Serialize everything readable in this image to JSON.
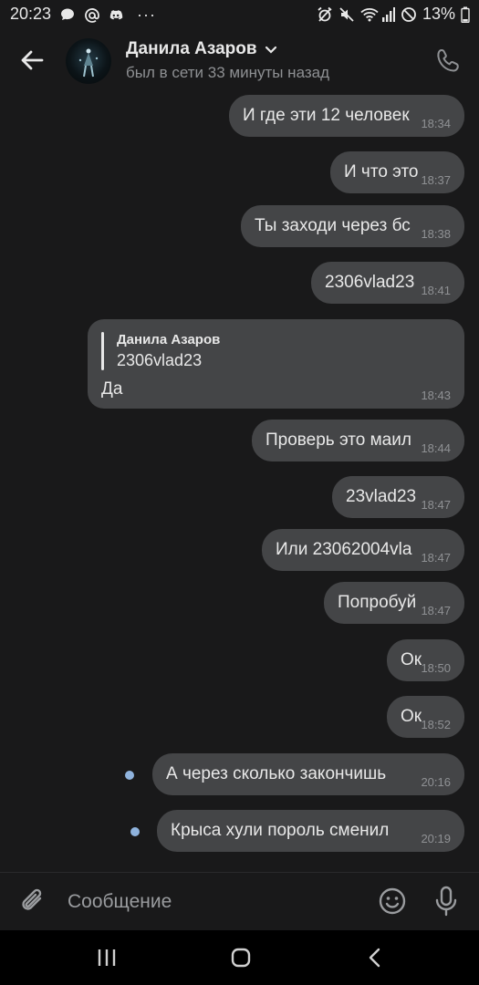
{
  "status_bar": {
    "time": "20:23",
    "more_dots": "···",
    "battery_percent": "13%",
    "left_icons": [
      "chat-bubble-icon",
      "at-sign-icon",
      "discord-icon"
    ],
    "right_icons": [
      "alarm-off-icon",
      "mute-icon",
      "wifi-icon",
      "signal-icon",
      "do-not-disturb-icon",
      "battery-icon"
    ]
  },
  "header": {
    "contact_name": "Данила Азаров",
    "contact_status": "был в сети 33 минуты назад",
    "icons": {
      "back": "arrow-left-icon",
      "call": "phone-icon",
      "chevron": "chevron-down-icon"
    }
  },
  "messages": [
    {
      "text": "И где эти 12 человек",
      "time": "18:34"
    },
    {
      "text": "И что это",
      "time": "18:37"
    },
    {
      "text": "Ты заходи через бс",
      "time": "18:38"
    },
    {
      "text": "2306vlad23",
      "time": "18:41"
    },
    {
      "reply_author": "Данила Азаров",
      "reply_quote": "2306vlad23",
      "text": "Да",
      "time": "18:43"
    },
    {
      "text": "Проверь это маил",
      "time": "18:44"
    },
    {
      "text": "23vlad23",
      "time": "18:47"
    },
    {
      "text": "Или 23062004vla",
      "time": "18:47"
    },
    {
      "text": "Попробуй",
      "time": "18:47"
    },
    {
      "text": "Ок",
      "time": "18:50"
    },
    {
      "text": "Ок",
      "time": "18:52"
    },
    {
      "text": "А через сколько закончишь",
      "time": "20:16",
      "unread": true
    },
    {
      "text": "Крыса хули пороль сменил",
      "time": "20:19",
      "unread": true
    }
  ],
  "composer": {
    "placeholder": "Сообщение",
    "icons": {
      "attach": "paperclip-icon",
      "emoji": "smiley-icon",
      "voice": "microphone-icon"
    }
  },
  "nav_bar": {
    "icons": [
      "recent-apps-icon",
      "home-icon",
      "back-icon"
    ]
  },
  "colors": {
    "background": "#19191a",
    "bubble": "#444547",
    "text": "#e8e8e8",
    "secondary_text": "#8e9093",
    "unread_dot": "#8fb3dd"
  }
}
